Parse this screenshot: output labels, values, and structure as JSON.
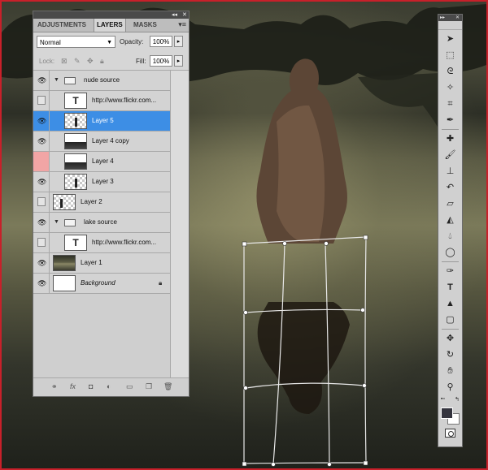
{
  "panel": {
    "tabs": [
      "ADJUSTMENTS",
      "LAYERS",
      "MASKS"
    ],
    "active_tab": "LAYERS",
    "collapse_icon": "double-chevron-icon",
    "close_icon": "close-icon",
    "menu_icon": "panel-menu-icon",
    "blend_mode": "Normal",
    "opacity_label": "Opacity:",
    "opacity_value": "100%",
    "lock_label": "Lock:",
    "fill_label": "Fill:",
    "fill_value": "100%"
  },
  "layers": [
    {
      "name": "nude source",
      "kind": "group",
      "visible": true
    },
    {
      "name": "http://www.flickr.com...",
      "kind": "text",
      "visible": false
    },
    {
      "name": "Layer 5",
      "kind": "layer",
      "visible": true,
      "selected": true
    },
    {
      "name": "Layer 4 copy",
      "kind": "layer",
      "visible": true
    },
    {
      "name": "Layer 4",
      "kind": "layer",
      "visible": false,
      "flag_color": "#f1a5a5"
    },
    {
      "name": "Layer 3",
      "kind": "layer",
      "visible": true
    },
    {
      "name": "Layer 2",
      "kind": "layer",
      "visible": false
    },
    {
      "name": "lake source",
      "kind": "group",
      "visible": true
    },
    {
      "name": "http://www.flickr.com...",
      "kind": "text",
      "visible": false
    },
    {
      "name": "Layer 1",
      "kind": "layer",
      "visible": true
    },
    {
      "name": "Background",
      "kind": "background",
      "visible": true,
      "locked": true
    }
  ],
  "text_layer_glyph": "T",
  "bottom_icons": [
    "link-layers-icon",
    "fx-icon",
    "add-mask-icon",
    "adjustment-layer-icon",
    "new-group-icon",
    "new-layer-icon",
    "trash-icon"
  ],
  "bottom_fx": "fx",
  "tools": [
    "move-tool-icon",
    "marquee-tool-icon",
    "lasso-tool-icon",
    "quick-selection-tool-icon",
    "crop-tool-icon",
    "eyedropper-tool-icon",
    "healing-brush-tool-icon",
    "brush-tool-icon",
    "clone-stamp-tool-icon",
    "history-brush-tool-icon",
    "eraser-tool-icon",
    "paint-bucket-tool-icon",
    "blur-tool-icon",
    "dodge-tool-icon",
    "pen-tool-icon",
    "type-tool-icon",
    "path-selection-tool-icon",
    "shape-tool-icon",
    "3d-rotate-tool-icon",
    "3d-orbit-tool-icon",
    "hand-tool-icon",
    "zoom-tool-icon"
  ],
  "type_tool_glyph": "T",
  "colors": {
    "foreground": "#34343e",
    "background": "#ffffff",
    "selection": "#3d8ee5",
    "frame_border": "#c8202a"
  }
}
